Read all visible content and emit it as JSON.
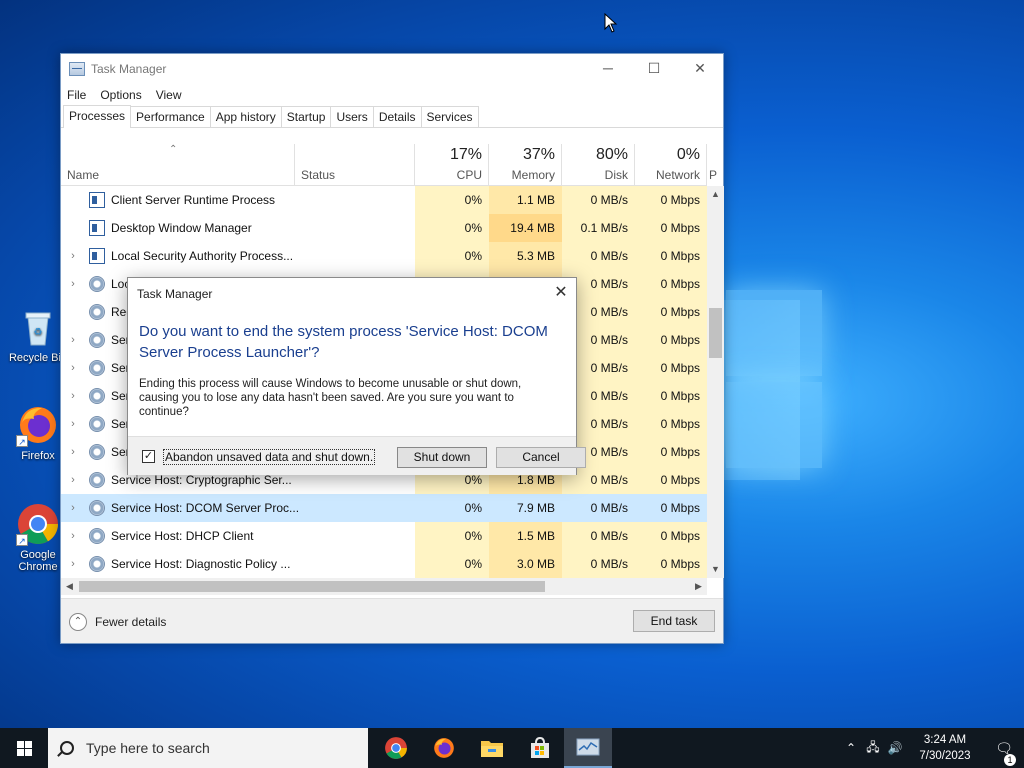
{
  "desktop": {
    "icons": [
      {
        "label": "Recycle Bin"
      },
      {
        "label": "Firefox"
      },
      {
        "label": "Google Chrome"
      }
    ]
  },
  "task_manager": {
    "title": "Task Manager",
    "menu": [
      "File",
      "Options",
      "View"
    ],
    "tabs": [
      "Processes",
      "Performance",
      "App history",
      "Startup",
      "Users",
      "Details",
      "Services"
    ],
    "columns": {
      "name": "Name",
      "status": "Status",
      "cpu": {
        "pct": "17%",
        "label": "CPU"
      },
      "memory": {
        "pct": "37%",
        "label": "Memory"
      },
      "disk": {
        "pct": "80%",
        "label": "Disk"
      },
      "network": {
        "pct": "0%",
        "label": "Network"
      },
      "power": "P"
    },
    "rows": [
      {
        "name": "Client Server Runtime Process",
        "cpu": "0%",
        "mem": "1.1 MB",
        "disk": "0 MB/s",
        "net": "0 Mbps"
      },
      {
        "name": "Desktop Window Manager",
        "cpu": "0%",
        "mem": "19.4 MB",
        "disk": "0.1 MB/s",
        "net": "0 Mbps"
      },
      {
        "name": "Local Security Authority Process...",
        "cpu": "0%",
        "mem": "5.3 MB",
        "disk": "0 MB/s",
        "net": "0 Mbps"
      },
      {
        "name": "Loc",
        "cpu": "",
        "mem": "",
        "disk": "0 MB/s",
        "net": "0 Mbps"
      },
      {
        "name": "Reg",
        "cpu": "",
        "mem": "",
        "disk": "0 MB/s",
        "net": "0 Mbps"
      },
      {
        "name": "Ser",
        "cpu": "",
        "mem": "",
        "disk": "0 MB/s",
        "net": "0 Mbps"
      },
      {
        "name": "Ser",
        "cpu": "",
        "mem": "",
        "disk": "0 MB/s",
        "net": "0 Mbps"
      },
      {
        "name": "Ser",
        "cpu": "",
        "mem": "",
        "disk": "0 MB/s",
        "net": "0 Mbps"
      },
      {
        "name": "Ser",
        "cpu": "",
        "mem": "",
        "disk": "0 MB/s",
        "net": "0 Mbps"
      },
      {
        "name": "Ser",
        "cpu": "",
        "mem": "",
        "disk": "0 MB/s",
        "net": "0 Mbps"
      },
      {
        "name": "Service Host: Cryptographic Ser...",
        "cpu": "0%",
        "mem": "1.8 MB",
        "disk": "0 MB/s",
        "net": "0 Mbps"
      },
      {
        "name": "Service Host: DCOM Server Proc...",
        "cpu": "0%",
        "mem": "7.9 MB",
        "disk": "0 MB/s",
        "net": "0 Mbps"
      },
      {
        "name": "Service Host: DHCP Client",
        "cpu": "0%",
        "mem": "1.5 MB",
        "disk": "0 MB/s",
        "net": "0 Mbps"
      },
      {
        "name": "Service Host: Diagnostic Policy ...",
        "cpu": "0%",
        "mem": "3.0 MB",
        "disk": "0 MB/s",
        "net": "0 Mbps"
      }
    ],
    "fewer_details": "Fewer details",
    "end_task": "End task"
  },
  "dialog": {
    "title": "Task Manager",
    "heading": "Do you want to end the system process 'Service Host: DCOM Server Process Launcher'?",
    "body": "Ending this process will cause Windows to become unusable or shut down, causing you to lose any data hasn't been saved. Are you sure you want to continue?",
    "checkbox_label": "Abandon unsaved data and shut down.",
    "shutdown_label": "Shut down",
    "cancel_label": "Cancel"
  },
  "taskbar": {
    "search_placeholder": "Type here to search",
    "time": "3:24 AM",
    "date": "7/30/2023",
    "notification_count": "1"
  }
}
